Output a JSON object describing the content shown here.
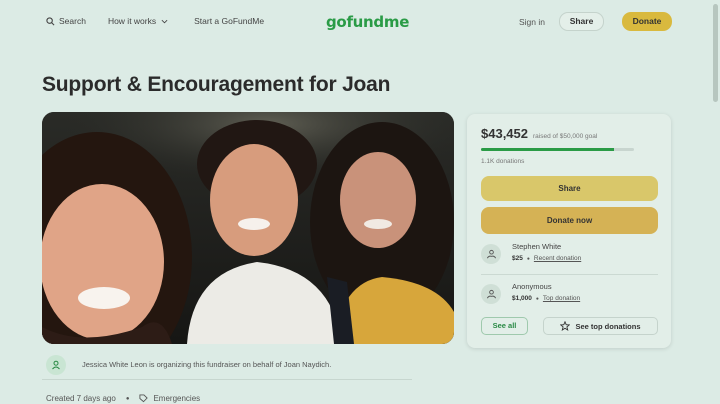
{
  "nav": {
    "search_label": "Search",
    "how_it_works_label": "How it works",
    "start_label": "Start a GoFundMe",
    "logo_text": "gofundme",
    "signin_label": "Sign in",
    "share_label": "Share",
    "donate_label": "Donate"
  },
  "campaign": {
    "title": "Support & Encouragement for Joan",
    "organizer_text": "Jessica White Leon is organizing this fundraiser on behalf of Joan Naydich.",
    "created_text": "Created 7 days ago",
    "category": "Emergencies"
  },
  "donation_card": {
    "raised": "$43,452",
    "goal_text": "raised of $50,000 goal",
    "progress_fraction": 0.87,
    "donation_count": "1.1K donations",
    "share_button": "Share",
    "donate_button": "Donate now",
    "donors": [
      {
        "name": "Stephen White",
        "amount": "$25",
        "note": "Recent donation"
      },
      {
        "name": "Anonymous",
        "amount": "$1,000",
        "note": "Top donation"
      }
    ],
    "see_all": "See all",
    "see_top": "See top donations"
  },
  "colors": {
    "brand_green": "#2a9b46",
    "donate_gold": "#d9b93e",
    "background": "#dcebe5"
  }
}
